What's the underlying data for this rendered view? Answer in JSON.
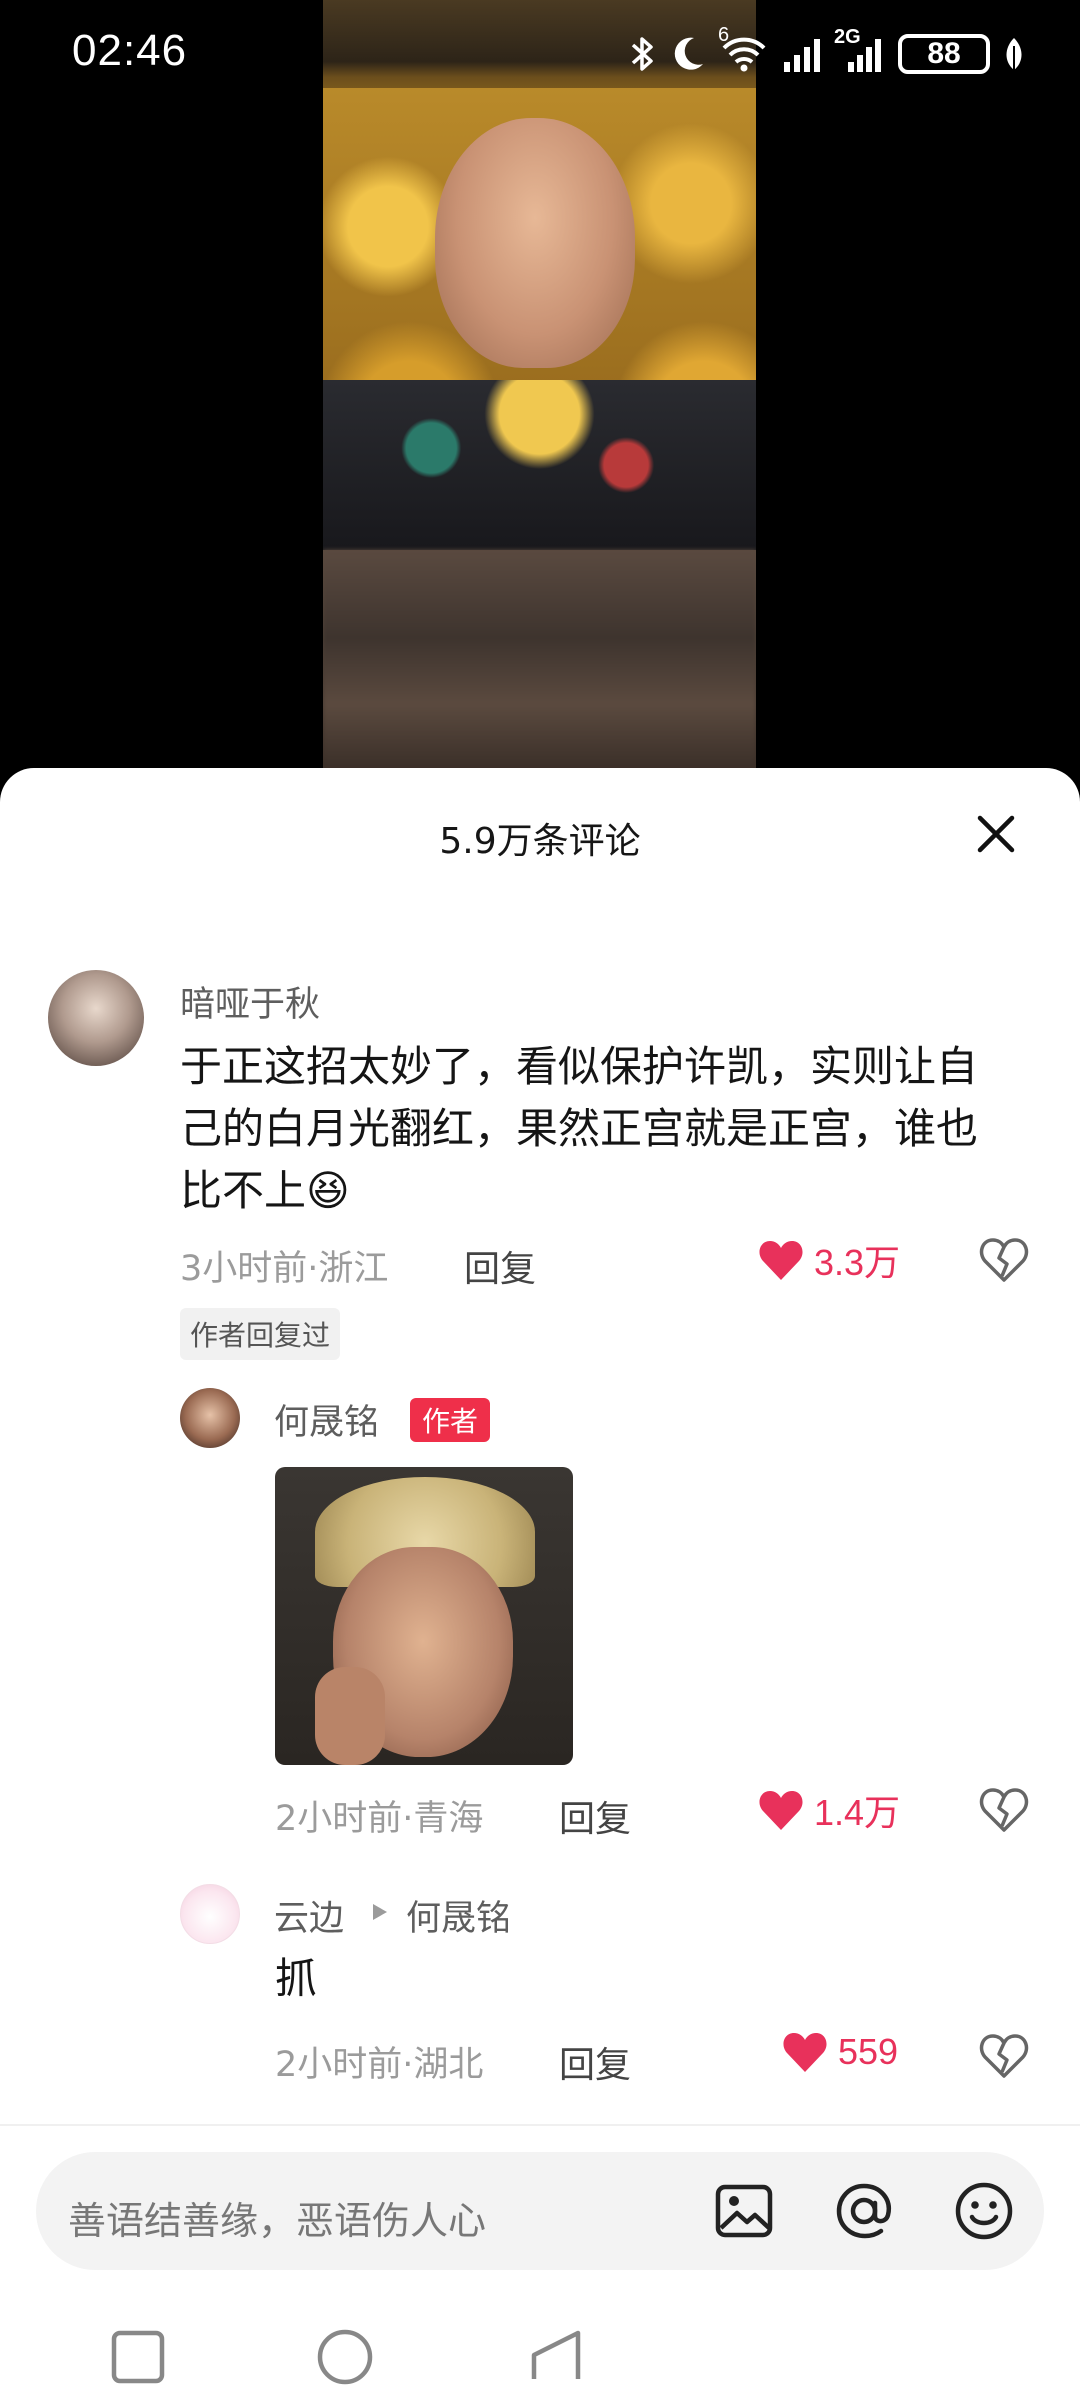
{
  "status_bar": {
    "time": "02:46",
    "network_label": "2G",
    "wifi_label": "6",
    "battery": "88",
    "icons": [
      "bluetooth-icon",
      "moon-icon",
      "wifi-icon",
      "signal-icon",
      "signal-icon",
      "battery-icon",
      "leaf-icon"
    ]
  },
  "comments_panel": {
    "title": "5.9万条评论",
    "close_icon": "close-icon"
  },
  "comments": [
    {
      "username": "暗哑于秋",
      "text_lines": [
        "于正这招太妙了，看似保护许凯，实则让自",
        "己的白月光翻红，果然正宫就是正宫，谁也",
        "比不上😆"
      ],
      "time_location": "3小时前·浙江",
      "reply_label": "回复",
      "likes": "3.3万",
      "author_replied_tag": "作者回复过"
    },
    {
      "username": "何晟铭",
      "badge": "作者",
      "time_location": "2小时前·青海",
      "reply_label": "回复",
      "likes": "1.4万"
    },
    {
      "username": "云边",
      "reply_to": "何晟铭",
      "text": "抓",
      "time_location": "2小时前·湖北",
      "reply_label": "回复",
      "likes": "559"
    }
  ],
  "input_bar": {
    "placeholder": "善语结善缘，恶语伤人心",
    "icons": [
      "image-icon",
      "at-icon",
      "emoji-icon"
    ]
  },
  "colors": {
    "like_red": "#e8315b",
    "badge_red": "#ef2f4a"
  }
}
